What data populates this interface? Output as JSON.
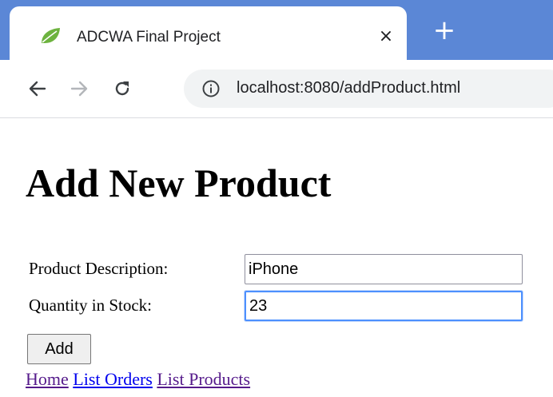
{
  "browser": {
    "tab_title": "ADCWA Final Project",
    "tab_close_glyph": "×",
    "new_tab_glyph": "+",
    "favicon": "spring-leaf-icon",
    "url": "localhost:8080/addProduct.html",
    "accent_color": "#5b87d6"
  },
  "page": {
    "title": "Add New Product",
    "fields": {
      "description": {
        "label": "Product Description:",
        "value": "iPhone"
      },
      "quantity": {
        "label": "Quantity in Stock:",
        "value": "23"
      }
    },
    "submit_label": "Add",
    "links": [
      "Home",
      "List Orders",
      "List Products"
    ]
  }
}
